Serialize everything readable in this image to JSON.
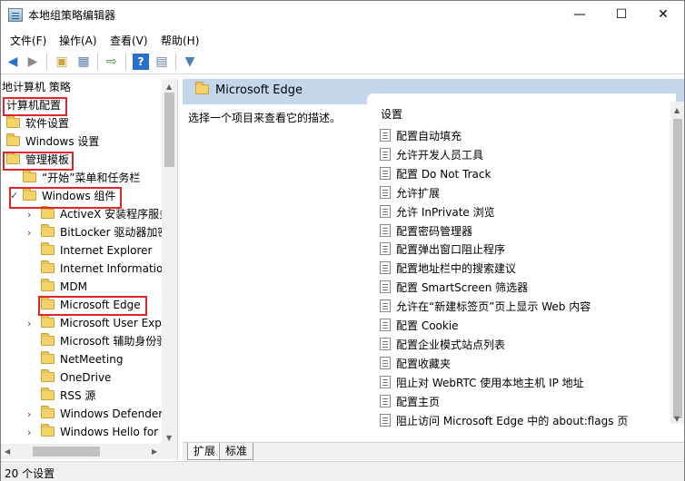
{
  "window": {
    "title": "本地组策略编辑器",
    "minimize": "—",
    "maximize": "☐",
    "close": "✕"
  },
  "menu": [
    "文件(F)",
    "操作(A)",
    "查看(V)",
    "帮助(H)"
  ],
  "toolbar": {
    "icons": [
      "back-arrow-icon",
      "forward-arrow-icon",
      "up-folder-icon",
      "show-hide-tree-icon",
      "export-list-icon",
      "help-icon",
      "properties-icon",
      "filter-icon"
    ]
  },
  "tree": {
    "root": "地计算机 策略",
    "items": [
      {
        "label": "计算机配置"
      },
      {
        "label": "软件设置"
      },
      {
        "label": "Windows 设置"
      },
      {
        "label": "管理模板"
      },
      {
        "label": "“开始”菜单和任务栏"
      },
      {
        "label": "Windows 组件"
      },
      {
        "label": "ActiveX 安装程序服务"
      },
      {
        "label": "BitLocker 驱动器加密"
      },
      {
        "label": "Internet Explorer"
      },
      {
        "label": "Internet Information"
      },
      {
        "label": "MDM"
      },
      {
        "label": "Microsoft Edge"
      },
      {
        "label": "Microsoft User Exp"
      },
      {
        "label": "Microsoft 辅助身份验"
      },
      {
        "label": "NetMeeting"
      },
      {
        "label": "OneDrive"
      },
      {
        "label": "RSS 源"
      },
      {
        "label": "Windows Defender"
      },
      {
        "label": "Windows Hello for"
      }
    ]
  },
  "right": {
    "header": "Microsoft Edge",
    "description": "选择一个项目来查看它的描述。",
    "column": "设置",
    "settings": [
      "配置自动填充",
      "允许开发人员工具",
      "配置 Do Not Track",
      "允许扩展",
      "允许 InPrivate 浏览",
      "配置密码管理器",
      "配置弹出窗口阻止程序",
      "配置地址栏中的搜索建议",
      "配置 SmartScreen 筛选器",
      "允许在“新建标签页”页上显示 Web 内容",
      "配置 Cookie",
      "配置企业模式站点列表",
      "配置收藏夹",
      "阻止对 WebRTC 使用本地主机 IP 地址",
      "配置主页",
      "阻止访问 Microsoft Edge 中的 about:flags 页"
    ]
  },
  "tabs": [
    "扩展",
    "标准"
  ],
  "status": "20 个设置",
  "colors": {
    "highlight_box": "#e0262b",
    "header_bg": "#c4d6ec",
    "folder": "#f5d36b"
  }
}
